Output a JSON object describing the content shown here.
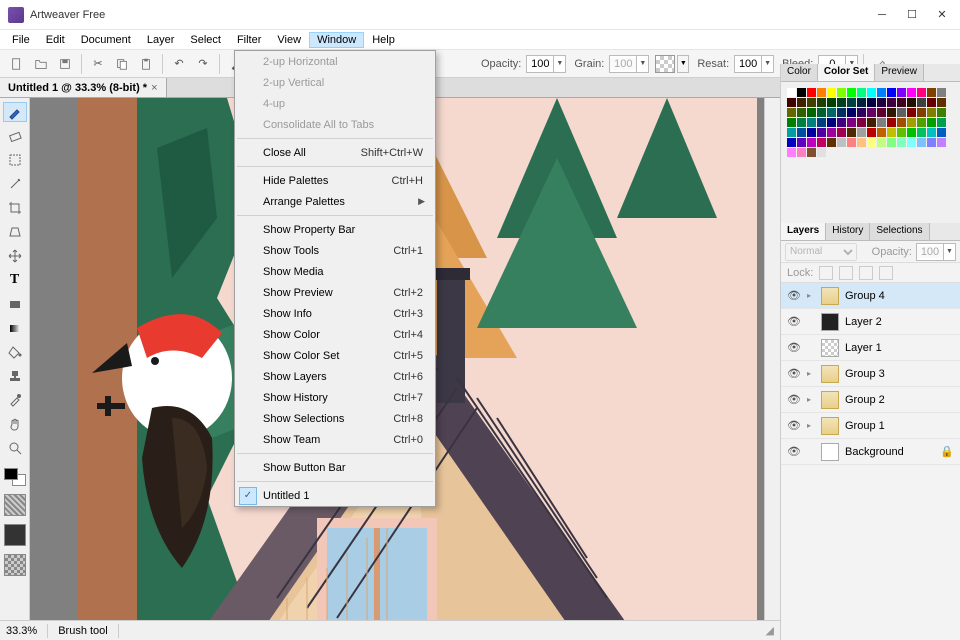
{
  "app_title": "Artweaver Free",
  "menubar": [
    "File",
    "Edit",
    "Document",
    "Layer",
    "Select",
    "Filter",
    "View",
    "Window",
    "Help"
  ],
  "menubar_active_index": 7,
  "toolbar_opts": {
    "opacity_label": "Opacity:",
    "opacity": "100",
    "grain_label": "Grain:",
    "grain": "100",
    "resat_label": "Resat:",
    "resat": "100",
    "bleed_label": "Bleed:",
    "bleed": "0"
  },
  "doc_tab": "Untitled 1 @ 33.3% (8-bit) *",
  "dropdown": [
    {
      "label": "2-up Horizontal",
      "disabled": true
    },
    {
      "label": "2-up Vertical",
      "disabled": true
    },
    {
      "label": "4-up",
      "disabled": true
    },
    {
      "label": "Consolidate All to Tabs",
      "disabled": true
    },
    {
      "sep": true
    },
    {
      "label": "Close All",
      "shortcut": "Shift+Ctrl+W"
    },
    {
      "sep": true
    },
    {
      "label": "Hide Palettes",
      "shortcut": "Ctrl+H"
    },
    {
      "label": "Arrange Palettes",
      "arrow": true
    },
    {
      "sep": true
    },
    {
      "label": "Show Property Bar"
    },
    {
      "label": "Show Tools",
      "shortcut": "Ctrl+1"
    },
    {
      "label": "Show Media"
    },
    {
      "label": "Show Preview",
      "shortcut": "Ctrl+2"
    },
    {
      "label": "Show Info",
      "shortcut": "Ctrl+3"
    },
    {
      "label": "Show Color",
      "shortcut": "Ctrl+4"
    },
    {
      "label": "Show Color Set",
      "shortcut": "Ctrl+5"
    },
    {
      "label": "Show Layers",
      "shortcut": "Ctrl+6"
    },
    {
      "label": "Show History",
      "shortcut": "Ctrl+7"
    },
    {
      "label": "Show Selections",
      "shortcut": "Ctrl+8"
    },
    {
      "label": "Show Team",
      "shortcut": "Ctrl+0"
    },
    {
      "sep": true
    },
    {
      "label": "Show Button Bar"
    },
    {
      "sep": true
    },
    {
      "label": "Untitled 1",
      "checked": true
    }
  ],
  "color_tabs": [
    "Color",
    "Color Set",
    "Preview"
  ],
  "color_tab_active": 1,
  "layer_tabs": [
    "Layers",
    "History",
    "Selections"
  ],
  "layer_tab_active": 0,
  "layer_blend": "Normal",
  "layer_opacity_label": "Opacity:",
  "layer_opacity": "100",
  "lock_label": "Lock:",
  "layers": [
    {
      "name": "Group 4",
      "folder": true,
      "tri": true,
      "sel": true
    },
    {
      "name": "Layer 2",
      "thumb": "dark"
    },
    {
      "name": "Layer 1",
      "thumb": "checker"
    },
    {
      "name": "Group 3",
      "folder": true,
      "tri": true
    },
    {
      "name": "Group 2",
      "folder": true,
      "tri": true
    },
    {
      "name": "Group 1",
      "folder": true,
      "tri": true
    },
    {
      "name": "Background",
      "thumb": "white",
      "locked": true
    }
  ],
  "status": {
    "zoom": "33.3%",
    "tool": "Brush tool"
  },
  "swatch_colors": [
    "#fff",
    "#000",
    "#f00",
    "#ff8000",
    "#ff0",
    "#80ff00",
    "#0f0",
    "#00ff80",
    "#0ff",
    "#0080ff",
    "#00f",
    "#8000ff",
    "#f0f",
    "#ff0080",
    "#804000",
    "#808080",
    "#400000",
    "#402000",
    "#404000",
    "#204000",
    "#004000",
    "#004020",
    "#004040",
    "#002040",
    "#000040",
    "#200040",
    "#400040",
    "#400020",
    "#201000",
    "#404040",
    "#600",
    "#603000",
    "#660",
    "#306000",
    "#060",
    "#006030",
    "#066",
    "#003060",
    "#006",
    "#300060",
    "#606",
    "#600030",
    "#301800",
    "#606060",
    "#800000",
    "#804000",
    "#808000",
    "#408000",
    "#008000",
    "#008040",
    "#008080",
    "#004080",
    "#000080",
    "#400080",
    "#800080",
    "#800040",
    "#402000",
    "#808080",
    "#a00000",
    "#a05000",
    "#a0a000",
    "#50a000",
    "#00a000",
    "#00a050",
    "#00a0a0",
    "#0050a0",
    "#0000a0",
    "#5000a0",
    "#a000a0",
    "#a00050",
    "#502800",
    "#a0a0a0",
    "#c00000",
    "#c06000",
    "#c0c000",
    "#60c000",
    "#00c000",
    "#00c060",
    "#00c0c0",
    "#0060c0",
    "#0000c0",
    "#6000c0",
    "#c000c0",
    "#c00060",
    "#603000",
    "#c0c0c0",
    "#ff8080",
    "#ffc080",
    "#ffff80",
    "#c0ff80",
    "#80ff80",
    "#80ffc0",
    "#80ffff",
    "#80c0ff",
    "#8080ff",
    "#c080ff",
    "#ff80ff",
    "#ff80c0",
    "#805030",
    "#e0e0e0"
  ]
}
